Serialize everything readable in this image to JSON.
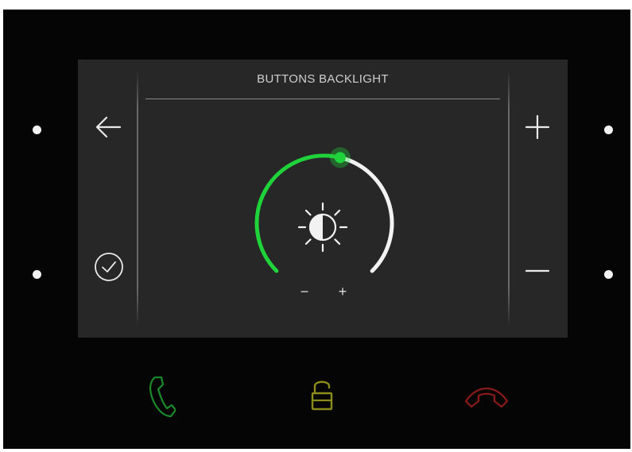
{
  "screen": {
    "title": "BUTTONS BACKLIGHT"
  },
  "dial": {
    "level": 0.55,
    "minus_label": "−",
    "plus_label": "+"
  },
  "icons": {
    "back": "arrow-left-icon",
    "confirm": "check-circle-icon",
    "increase": "plus-icon",
    "decrease": "minus-icon",
    "brightness": "brightness-contrast-icon",
    "call": "phone-call-icon",
    "unlock": "unlock-padlock-icon",
    "hangup": "phone-hangup-icon"
  },
  "colors": {
    "accent": "#1fd33a",
    "call": "#1a8a2a",
    "unlock": "#8c8c1a",
    "hangup": "#8a1a1a",
    "screen_bg": "#272727",
    "device_bg": "#050505"
  }
}
